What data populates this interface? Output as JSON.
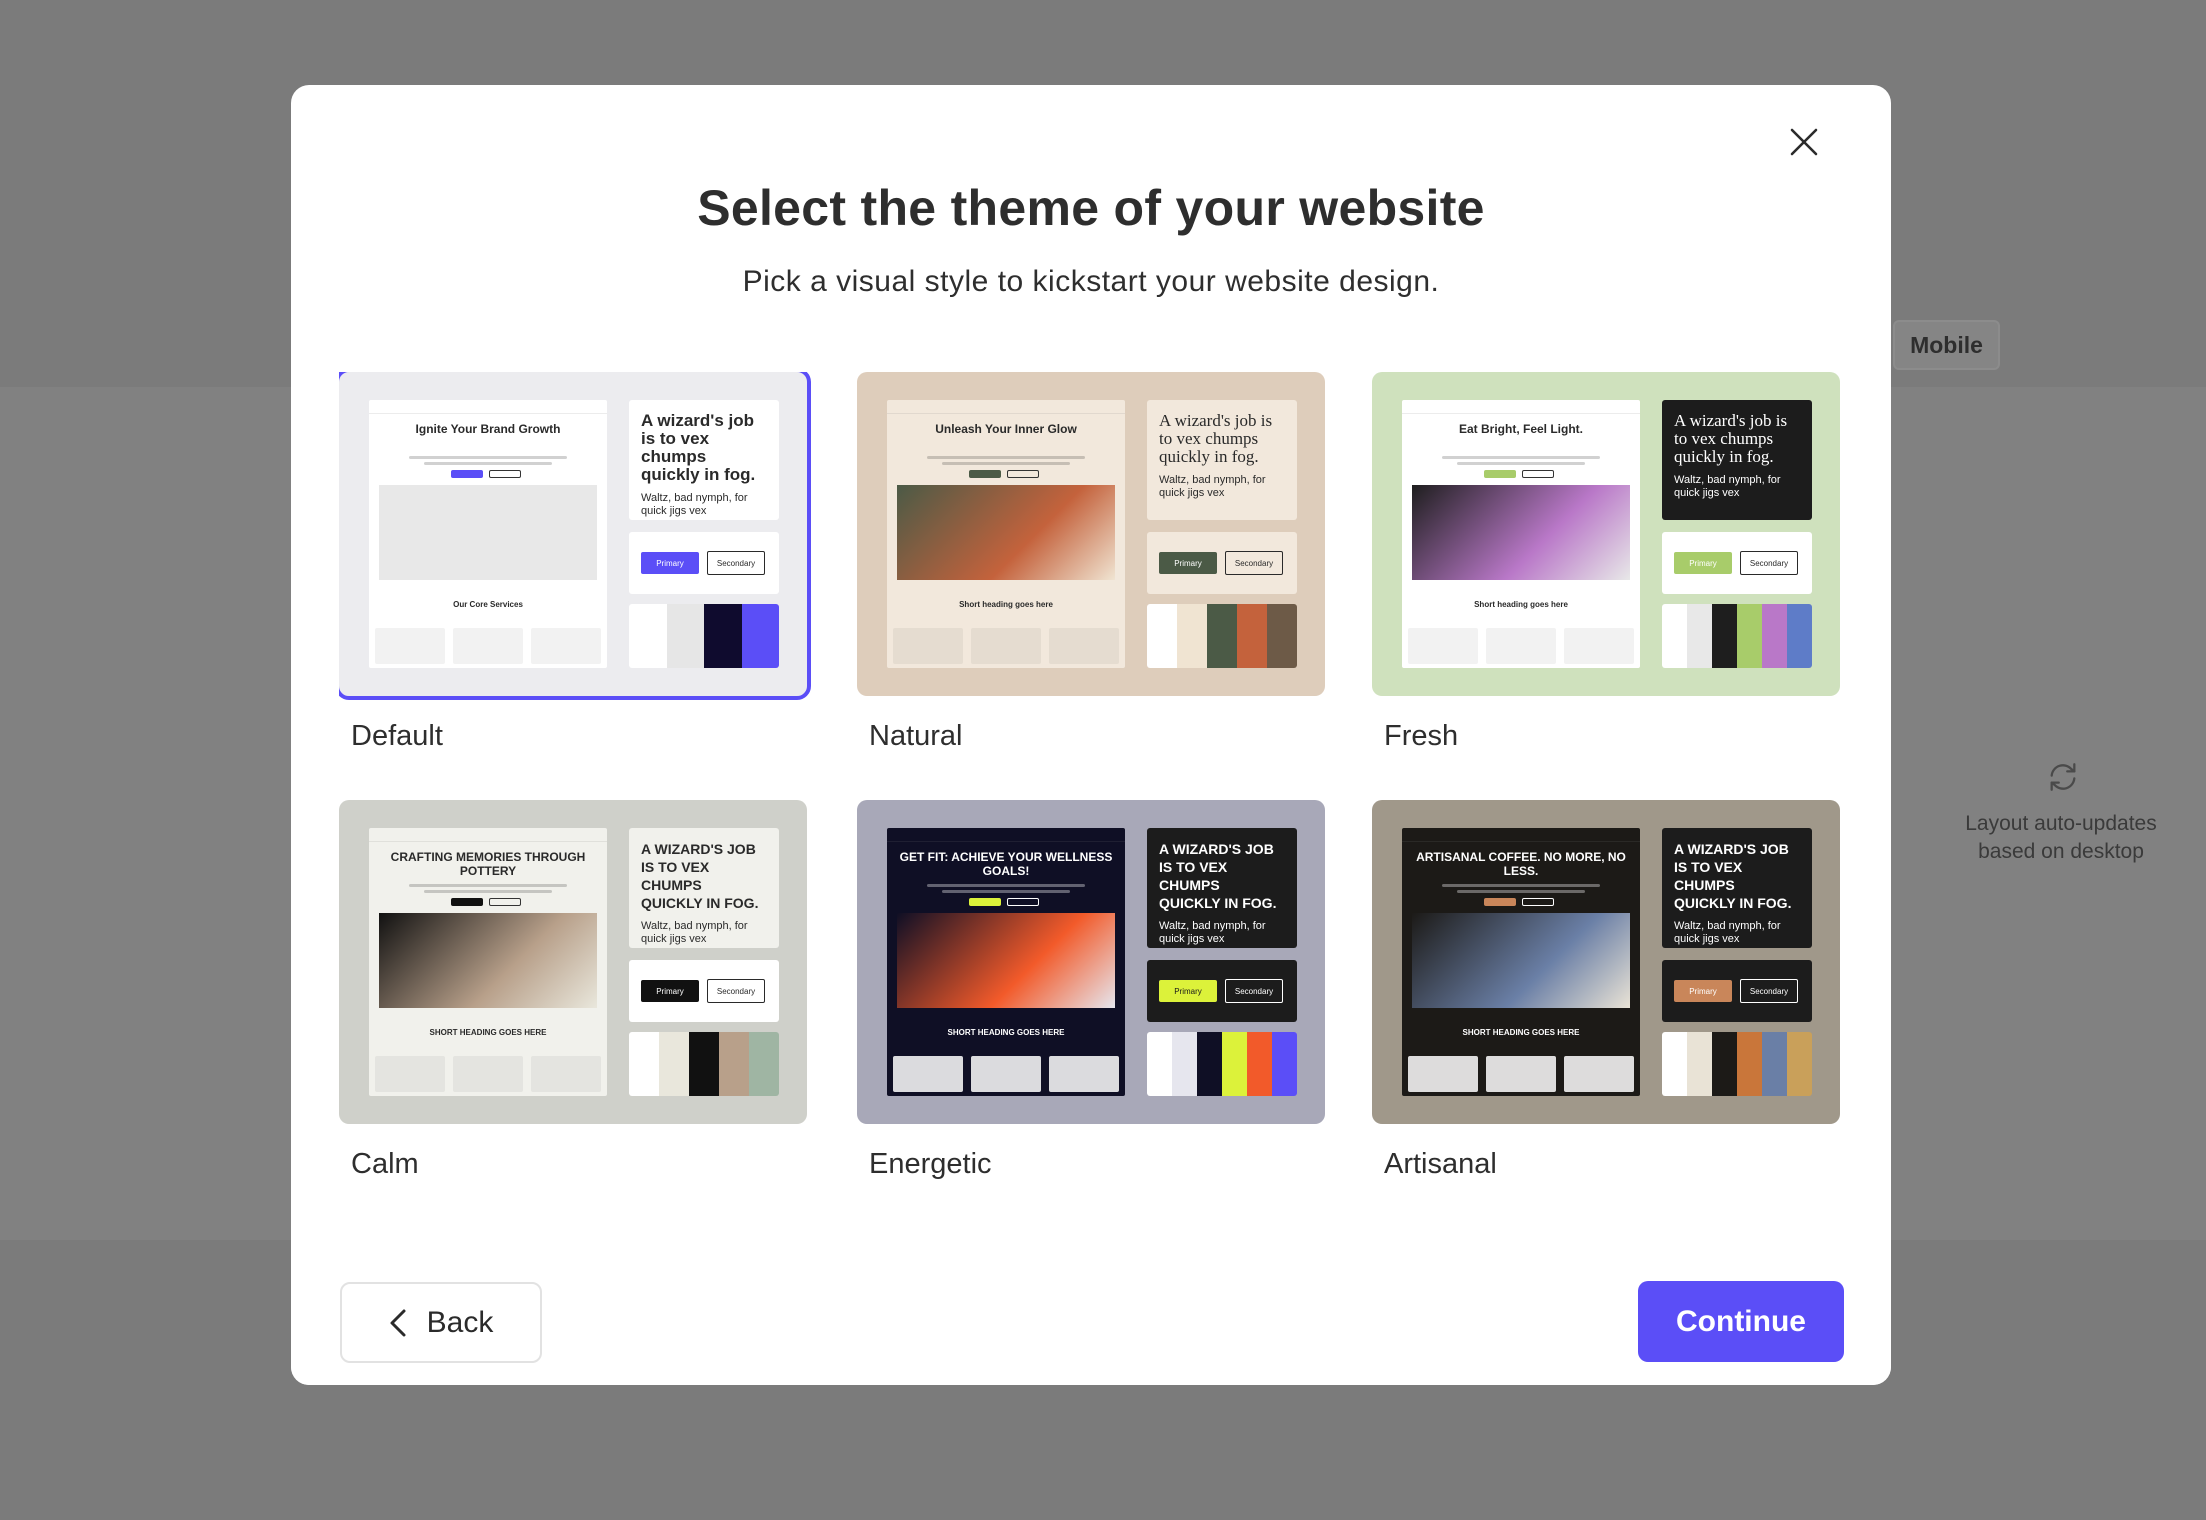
{
  "background": {
    "mobile_tab": "Mobile",
    "auto_update_line1": "Layout auto-updates",
    "auto_update_line2": "based on desktop"
  },
  "modal": {
    "title": "Select the theme of your website",
    "subtitle": "Pick a visual style to kickstart your website design.",
    "back_label": "Back",
    "continue_label": "Continue",
    "accent_color": "#5b4ef7",
    "selected_theme": "Default"
  },
  "themes": [
    {
      "label": "Default",
      "bg": "#ececef",
      "mock_bg": "#ffffff",
      "mock_heading": "Ignite Your Brand Growth",
      "mock_sub": "Our Core Services",
      "panel_title": "A wizard's job is to vex chumps quickly in fog.",
      "panel_body": "Waltz, bad nymph, for quick jigs vex",
      "primary_label": "Primary",
      "secondary_label": "Secondary",
      "primary_color": "#5b4ef7",
      "swatches": [
        "#ffffff",
        "#e6e6e6",
        "#0f0b2e",
        "#5b4ef7"
      ]
    },
    {
      "label": "Natural",
      "bg": "#decdbb",
      "mock_bg": "#f2e8dc",
      "mock_heading": "Unleash Your Inner Glow",
      "mock_sub": "Short heading goes here",
      "panel_title": "A wizard's job is to vex chumps quickly in fog.",
      "panel_body": "Waltz, bad nymph, for quick jigs vex",
      "primary_label": "Primary",
      "secondary_label": "Secondary",
      "primary_color": "#4b5a46",
      "swatches": [
        "#ffffff",
        "#f0e4d2",
        "#4b5a46",
        "#c4623c",
        "#6d5a47"
      ]
    },
    {
      "label": "Fresh",
      "bg": "#cfe1bd",
      "mock_bg": "#ffffff",
      "mock_heading": "Eat Bright, Feel Light.",
      "mock_sub": "Short heading goes here",
      "panel_title": "A wizard's job is to vex chumps quickly in fog.",
      "panel_body": "Waltz, bad nymph, for quick jigs vex",
      "primary_label": "Primary",
      "secondary_label": "Secondary",
      "primary_color": "#a8cc6a",
      "swatches": [
        "#ffffff",
        "#e8e8e8",
        "#1e1e1e",
        "#a8cc6a",
        "#b978c8",
        "#5e7cc8"
      ]
    },
    {
      "label": "Calm",
      "bg": "#cfd0ca",
      "mock_bg": "#f1f1ec",
      "mock_heading": "CRAFTING MEMORIES THROUGH POTTERY",
      "mock_sub": "SHORT HEADING GOES HERE",
      "panel_title": "A WIZARD'S JOB IS TO VEX CHUMPS QUICKLY IN FOG.",
      "panel_body": "Waltz, bad nymph, for quick jigs vex",
      "primary_label": "Primary",
      "secondary_label": "Secondary",
      "primary_color": "#111111",
      "swatches": [
        "#ffffff",
        "#e9e7dc",
        "#111111",
        "#b8a08a",
        "#9fb5a3"
      ]
    },
    {
      "label": "Energetic",
      "bg": "#a8a8b8",
      "mock_bg": "#0f0f25",
      "mock_heading": "GET FIT: ACHIEVE YOUR WELLNESS GOALS!",
      "mock_sub": "SHORT HEADING GOES HERE",
      "panel_title": "A WIZARD'S JOB IS TO VEX CHUMPS QUICKLY IN FOG.",
      "panel_body": "Waltz, bad nymph, for quick jigs vex",
      "primary_label": "Primary",
      "secondary_label": "Secondary",
      "primary_color": "#dcf23a",
      "swatches": [
        "#ffffff",
        "#e6e6ee",
        "#0f0f25",
        "#dcf23a",
        "#f25a2a",
        "#5b4ef7"
      ]
    },
    {
      "label": "Artisanal",
      "bg": "#a0988a",
      "mock_bg": "#1c1a17",
      "mock_heading": "ARTISANAL COFFEE. NO MORE, NO LESS.",
      "mock_sub": "SHORT HEADING GOES HERE",
      "panel_title": "A WIZARD'S JOB IS TO VEX CHUMPS QUICKLY IN FOG.",
      "panel_body": "Waltz, bad nymph, for quick jigs vex",
      "primary_label": "Primary",
      "secondary_label": "Secondary",
      "primary_color": "#c9865a",
      "swatches": [
        "#ffffff",
        "#e9e3d6",
        "#1c1a17",
        "#c9763a",
        "#6a7fa6",
        "#c9a05a"
      ]
    }
  ],
  "partial_rows": [
    {
      "color": "#f0cfc8"
    },
    {
      "color": "#d6e2cc"
    },
    {
      "color": "#0a3aa5"
    }
  ]
}
